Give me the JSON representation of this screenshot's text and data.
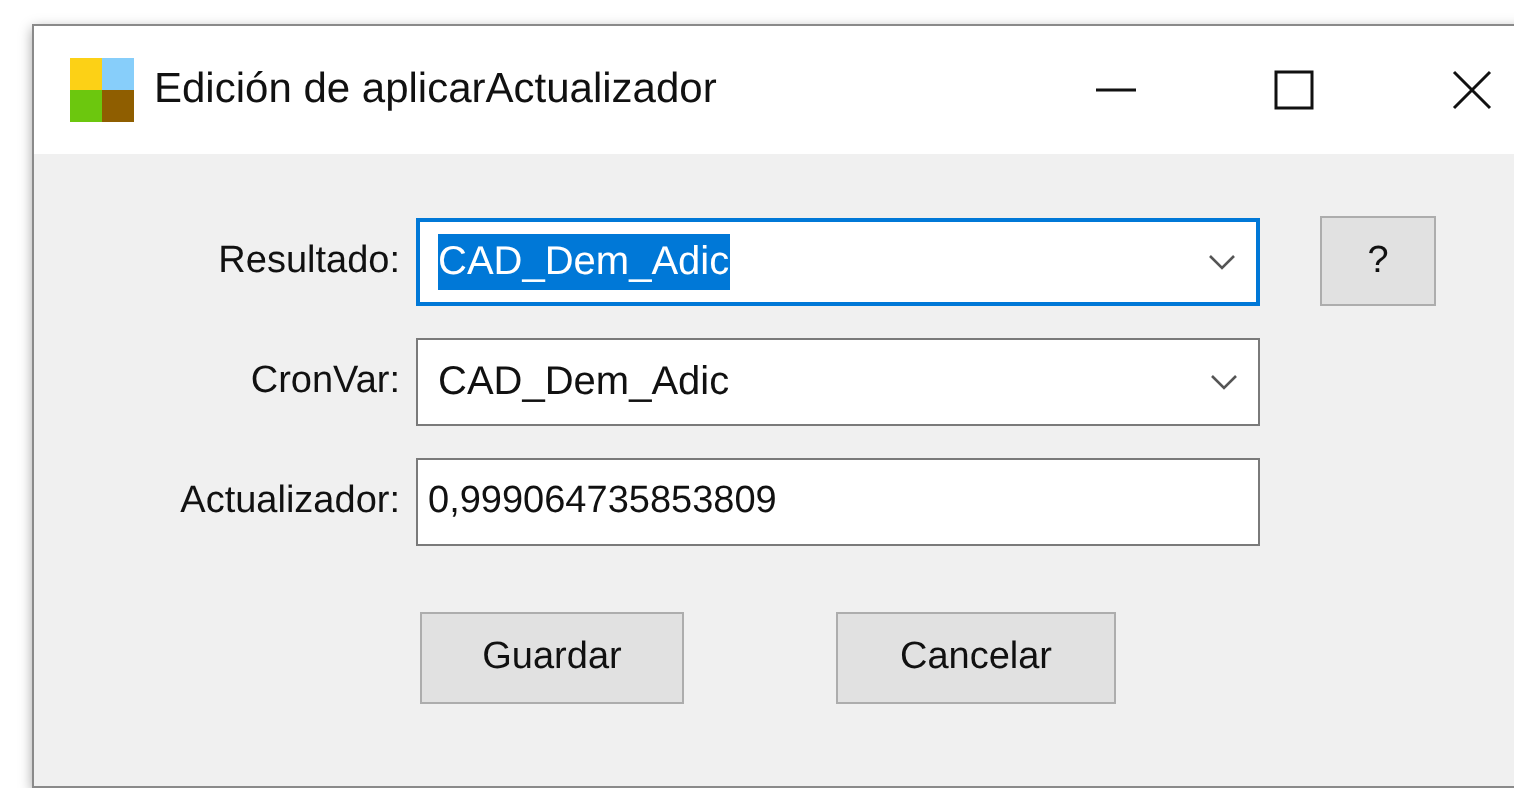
{
  "window": {
    "title": "Edición de aplicarActualizador"
  },
  "fields": [
    {
      "kind": "combo",
      "label": "Resultado:",
      "value": "CAD_Dem_Adic",
      "focused": true
    },
    {
      "kind": "combo",
      "label": "CronVar:",
      "value": "CAD_Dem_Adic",
      "focused": false
    },
    {
      "kind": "text",
      "label": "Actualizador:",
      "value": "0,999064735853809",
      "focused": false
    }
  ],
  "help_button": "?",
  "buttons": [
    "Guardar",
    "Cancelar"
  ]
}
